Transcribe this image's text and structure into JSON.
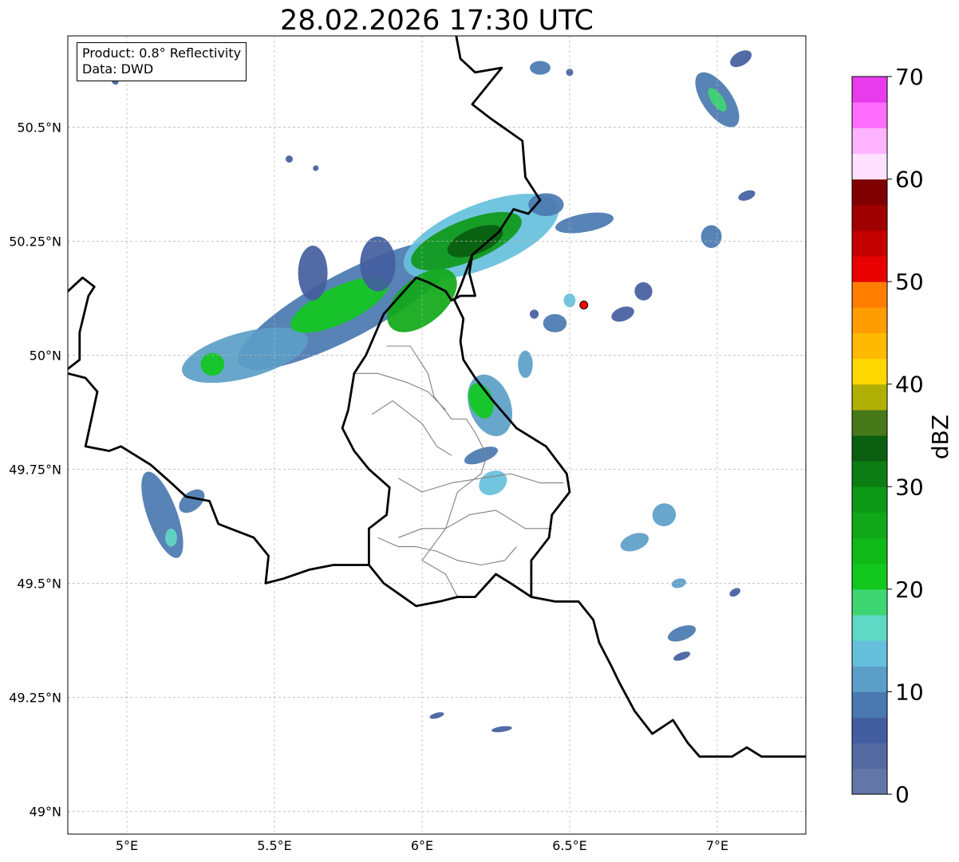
{
  "title": "28.02.2026 17:30 UTC",
  "info": {
    "product": "Product: 0.8° Reflectivity",
    "data": "Data: DWD"
  },
  "map": {
    "lon_range": [
      4.8,
      7.3
    ],
    "lat_range": [
      48.95,
      50.7
    ],
    "lon_ticks": [
      {
        "value": 5.0,
        "label": "5°E"
      },
      {
        "value": 5.5,
        "label": "5.5°E"
      },
      {
        "value": 6.0,
        "label": "6°E"
      },
      {
        "value": 6.5,
        "label": "6.5°E"
      },
      {
        "value": 7.0,
        "label": "7°E"
      }
    ],
    "lat_ticks": [
      {
        "value": 49.0,
        "label": "49°N"
      },
      {
        "value": 49.25,
        "label": "49.25°N"
      },
      {
        "value": 49.5,
        "label": "49.5°N"
      },
      {
        "value": 49.75,
        "label": "49.75°N"
      },
      {
        "value": 50.0,
        "label": "50°N"
      },
      {
        "value": 50.25,
        "label": "50.25°N"
      },
      {
        "value": 50.5,
        "label": "50.5°N"
      }
    ],
    "grid": true,
    "radar_site": {
      "lon": 6.548,
      "lat": 50.11,
      "color": "#ff0000"
    }
  },
  "colorbar": {
    "label": "dBZ",
    "min": 0,
    "max": 70,
    "tick_labels": [
      {
        "value": 0,
        "label": "0"
      },
      {
        "value": 10,
        "label": "10"
      },
      {
        "value": 20,
        "label": "20"
      },
      {
        "value": 30,
        "label": "30"
      },
      {
        "value": 40,
        "label": "40"
      },
      {
        "value": 50,
        "label": "50"
      },
      {
        "value": 60,
        "label": "60"
      },
      {
        "value": 70,
        "label": "70"
      }
    ],
    "colors": [
      "#6475a8",
      "#5469a0",
      "#435ea0",
      "#4a78b0",
      "#5b9ec8",
      "#66c0dc",
      "#5fd8c4",
      "#3ed672",
      "#12c81e",
      "#10b818",
      "#10a818",
      "#0e9818",
      "#0c7e14",
      "#0a5e10",
      "#47781a",
      "#b0b004",
      "#ffd800",
      "#ffba00",
      "#ff9c00",
      "#ff7e00",
      "#e80000",
      "#c40000",
      "#a00000",
      "#7e0000",
      "#ffe0ff",
      "#ffb4ff",
      "#ff6eff",
      "#e83cec"
    ]
  },
  "echoes": [
    {
      "lon": 5.75,
      "lat": 50.11,
      "rx": 0.42,
      "ry": 0.07,
      "rot": -28,
      "dbz": 8
    },
    {
      "lon": 5.4,
      "lat": 50.0,
      "rx": 0.22,
      "ry": 0.05,
      "rot": -15,
      "dbz": 12
    },
    {
      "lon": 5.72,
      "lat": 50.11,
      "rx": 0.18,
      "ry": 0.04,
      "rot": -25,
      "dbz": 22
    },
    {
      "lon": 6.2,
      "lat": 50.26,
      "rx": 0.28,
      "ry": 0.07,
      "rot": -22,
      "dbz": 14
    },
    {
      "lon": 6.15,
      "lat": 50.25,
      "rx": 0.2,
      "ry": 0.045,
      "rot": -22,
      "dbz": 28
    },
    {
      "lon": 6.18,
      "lat": 50.25,
      "rx": 0.1,
      "ry": 0.028,
      "rot": -22,
      "dbz": 34
    },
    {
      "lon": 6.0,
      "lat": 50.12,
      "rx": 0.14,
      "ry": 0.05,
      "rot": -40,
      "dbz": 27
    },
    {
      "lon": 6.42,
      "lat": 50.33,
      "rx": 0.06,
      "ry": 0.025,
      "rot": 0,
      "dbz": 8
    },
    {
      "lon": 6.55,
      "lat": 50.29,
      "rx": 0.1,
      "ry": 0.02,
      "rot": -10,
      "dbz": 8
    },
    {
      "lon": 5.85,
      "lat": 50.2,
      "rx": 0.06,
      "ry": 0.06,
      "rot": 0,
      "dbz": 7
    },
    {
      "lon": 5.63,
      "lat": 50.18,
      "rx": 0.05,
      "ry": 0.06,
      "rot": 0,
      "dbz": 7
    },
    {
      "lon": 5.29,
      "lat": 49.98,
      "rx": 0.04,
      "ry": 0.025,
      "rot": 0,
      "dbz": 20
    },
    {
      "lon": 6.23,
      "lat": 49.89,
      "rx": 0.07,
      "ry": 0.07,
      "rot": -20,
      "dbz": 12
    },
    {
      "lon": 6.2,
      "lat": 49.9,
      "rx": 0.04,
      "ry": 0.04,
      "rot": -20,
      "dbz": 21
    },
    {
      "lon": 6.2,
      "lat": 49.78,
      "rx": 0.06,
      "ry": 0.015,
      "rot": -20,
      "dbz": 8
    },
    {
      "lon": 6.24,
      "lat": 49.72,
      "rx": 0.05,
      "ry": 0.025,
      "rot": -30,
      "dbz": 13
    },
    {
      "lon": 6.35,
      "lat": 49.98,
      "rx": 0.025,
      "ry": 0.03,
      "rot": 0,
      "dbz": 12
    },
    {
      "lon": 5.12,
      "lat": 49.65,
      "rx": 0.05,
      "ry": 0.1,
      "rot": -20,
      "dbz": 9
    },
    {
      "lon": 5.15,
      "lat": 49.6,
      "rx": 0.02,
      "ry": 0.02,
      "rot": 0,
      "dbz": 17
    },
    {
      "lon": 5.22,
      "lat": 49.68,
      "rx": 0.05,
      "ry": 0.02,
      "rot": -40,
      "dbz": 8
    },
    {
      "lon": 6.82,
      "lat": 49.65,
      "rx": 0.04,
      "ry": 0.025,
      "rot": -25,
      "dbz": 10
    },
    {
      "lon": 6.72,
      "lat": 49.59,
      "rx": 0.05,
      "ry": 0.018,
      "rot": -20,
      "dbz": 12
    },
    {
      "lon": 7.0,
      "lat": 50.56,
      "rx": 0.05,
      "ry": 0.07,
      "rot": -35,
      "dbz": 9
    },
    {
      "lon": 7.0,
      "lat": 50.56,
      "rx": 0.02,
      "ry": 0.03,
      "rot": -35,
      "dbz": 19
    },
    {
      "lon": 7.08,
      "lat": 50.65,
      "rx": 0.04,
      "ry": 0.015,
      "rot": -30,
      "dbz": 7
    },
    {
      "lon": 6.98,
      "lat": 50.26,
      "rx": 0.035,
      "ry": 0.025,
      "rot": 0,
      "dbz": 8
    },
    {
      "lon": 7.1,
      "lat": 50.35,
      "rx": 0.03,
      "ry": 0.01,
      "rot": -20,
      "dbz": 7
    },
    {
      "lon": 6.4,
      "lat": 50.63,
      "rx": 0.035,
      "ry": 0.015,
      "rot": 0,
      "dbz": 9
    },
    {
      "lon": 6.5,
      "lat": 50.62,
      "rx": 0.012,
      "ry": 0.008,
      "rot": 0,
      "dbz": 7
    },
    {
      "lon": 6.45,
      "lat": 50.07,
      "rx": 0.04,
      "ry": 0.02,
      "rot": 0,
      "dbz": 8
    },
    {
      "lon": 6.5,
      "lat": 50.12,
      "rx": 0.02,
      "ry": 0.015,
      "rot": 0,
      "dbz": 13
    },
    {
      "lon": 6.68,
      "lat": 50.09,
      "rx": 0.04,
      "ry": 0.015,
      "rot": -20,
      "dbz": 7
    },
    {
      "lon": 6.75,
      "lat": 50.14,
      "rx": 0.03,
      "ry": 0.02,
      "rot": -20,
      "dbz": 7
    },
    {
      "lon": 6.38,
      "lat": 50.09,
      "rx": 0.015,
      "ry": 0.01,
      "rot": 0,
      "dbz": 7
    },
    {
      "lon": 6.88,
      "lat": 49.39,
      "rx": 0.05,
      "ry": 0.015,
      "rot": -20,
      "dbz": 8
    },
    {
      "lon": 6.88,
      "lat": 49.34,
      "rx": 0.03,
      "ry": 0.008,
      "rot": -20,
      "dbz": 7
    },
    {
      "lon": 6.87,
      "lat": 49.5,
      "rx": 0.025,
      "ry": 0.01,
      "rot": -15,
      "dbz": 12
    },
    {
      "lon": 7.06,
      "lat": 49.48,
      "rx": 0.02,
      "ry": 0.008,
      "rot": -30,
      "dbz": 7
    },
    {
      "lon": 5.55,
      "lat": 50.43,
      "rx": 0.012,
      "ry": 0.008,
      "rot": -50,
      "dbz": 7
    },
    {
      "lon": 5.64,
      "lat": 50.41,
      "rx": 0.01,
      "ry": 0.006,
      "rot": -40,
      "dbz": 7
    },
    {
      "lon": 4.96,
      "lat": 50.6,
      "rx": 0.01,
      "ry": 0.008,
      "rot": -50,
      "dbz": 7
    },
    {
      "lon": 6.05,
      "lat": 49.21,
      "rx": 0.025,
      "ry": 0.006,
      "rot": -15,
      "dbz": 7
    },
    {
      "lon": 6.27,
      "lat": 49.18,
      "rx": 0.035,
      "ry": 0.006,
      "rot": -8,
      "dbz": 7
    }
  ],
  "borders": {
    "national": [
      [
        [
          6.11,
          50.72
        ],
        [
          6.13,
          50.65
        ],
        [
          6.18,
          50.62
        ],
        [
          6.27,
          50.63
        ],
        [
          6.17,
          50.55
        ],
        [
          6.23,
          50.52
        ],
        [
          6.34,
          50.47
        ],
        [
          6.35,
          50.39
        ],
        [
          6.4,
          50.34
        ],
        [
          6.36,
          50.31
        ],
        [
          6.31,
          50.32
        ],
        [
          6.26,
          50.27
        ],
        [
          6.17,
          50.22
        ],
        [
          6.13,
          50.15
        ],
        [
          6.11,
          50.12
        ],
        [
          6.14,
          50.08
        ],
        [
          6.13,
          50.03
        ],
        [
          6.14,
          49.99
        ],
        [
          6.18,
          49.95
        ],
        [
          6.24,
          49.9
        ],
        [
          6.32,
          49.84
        ],
        [
          6.42,
          49.8
        ],
        [
          6.49,
          49.74
        ],
        [
          6.5,
          49.7
        ],
        [
          6.44,
          49.65
        ],
        [
          6.43,
          49.6
        ],
        [
          6.37,
          49.55
        ],
        [
          6.37,
          49.47
        ],
        [
          6.3,
          49.5
        ],
        [
          6.25,
          49.52
        ],
        [
          6.18,
          49.47
        ],
        [
          6.12,
          49.47
        ],
        [
          6.06,
          49.46
        ],
        [
          5.98,
          49.45
        ],
        [
          5.87,
          49.5
        ],
        [
          5.82,
          49.54
        ],
        [
          5.82,
          49.62
        ],
        [
          5.88,
          49.65
        ],
        [
          5.89,
          49.71
        ],
        [
          5.82,
          49.75
        ],
        [
          5.77,
          49.79
        ],
        [
          5.73,
          49.84
        ],
        [
          5.75,
          49.88
        ],
        [
          5.77,
          49.96
        ],
        [
          5.81,
          50.0
        ],
        [
          5.87,
          50.09
        ],
        [
          5.98,
          50.17
        ],
        [
          6.02,
          50.16
        ],
        [
          6.08,
          50.14
        ],
        [
          6.1,
          50.12
        ],
        [
          6.13,
          50.13
        ],
        [
          6.18,
          50.13
        ],
        [
          6.16,
          50.18
        ],
        [
          6.17,
          50.22
        ]
      ],
      [
        [
          6.37,
          49.47
        ],
        [
          6.45,
          49.46
        ],
        [
          6.53,
          49.46
        ],
        [
          6.58,
          49.42
        ],
        [
          6.6,
          49.37
        ],
        [
          6.64,
          49.32
        ],
        [
          6.67,
          49.28
        ],
        [
          6.72,
          49.22
        ],
        [
          6.78,
          49.17
        ],
        [
          6.85,
          49.2
        ],
        [
          6.9,
          49.15
        ],
        [
          6.94,
          49.12
        ],
        [
          7.05,
          49.12
        ],
        [
          7.1,
          49.14
        ],
        [
          7.15,
          49.12
        ],
        [
          7.2,
          49.12
        ],
        [
          7.25,
          49.12
        ],
        [
          7.3,
          49.12
        ]
      ],
      [
        [
          4.8,
          50.14
        ],
        [
          4.85,
          50.17
        ],
        [
          4.89,
          50.15
        ],
        [
          4.87,
          50.13
        ],
        [
          4.84,
          50.05
        ],
        [
          4.84,
          49.99
        ],
        [
          4.8,
          49.97
        ]
      ],
      [
        [
          4.8,
          49.96
        ],
        [
          4.86,
          49.95
        ],
        [
          4.9,
          49.92
        ],
        [
          4.86,
          49.8
        ],
        [
          4.94,
          49.79
        ],
        [
          4.98,
          49.8
        ],
        [
          5.08,
          49.76
        ],
        [
          5.15,
          49.72
        ],
        [
          5.2,
          49.69
        ],
        [
          5.28,
          49.68
        ],
        [
          5.31,
          49.63
        ],
        [
          5.35,
          49.62
        ],
        [
          5.43,
          49.6
        ],
        [
          5.48,
          49.56
        ],
        [
          5.47,
          49.5
        ],
        [
          5.53,
          49.51
        ],
        [
          5.62,
          49.53
        ],
        [
          5.7,
          49.54
        ],
        [
          5.82,
          49.54
        ]
      ]
    ],
    "internal": [
      [
        [
          5.88,
          50.02
        ],
        [
          5.96,
          50.02
        ],
        [
          6.02,
          49.96
        ],
        [
          6.04,
          49.91
        ],
        [
          6.1,
          49.86
        ],
        [
          6.15,
          49.86
        ],
        [
          6.18,
          49.83
        ],
        [
          6.22,
          49.78
        ],
        [
          6.2,
          49.74
        ],
        [
          6.12,
          49.7
        ],
        [
          6.08,
          49.62
        ],
        [
          6.0,
          49.55
        ],
        [
          6.08,
          49.52
        ],
        [
          6.12,
          49.47
        ]
      ],
      [
        [
          5.77,
          49.96
        ],
        [
          5.85,
          49.96
        ],
        [
          5.95,
          49.94
        ],
        [
          6.02,
          49.92
        ],
        [
          6.08,
          49.88
        ]
      ],
      [
        [
          5.83,
          49.87
        ],
        [
          5.9,
          49.9
        ],
        [
          6.0,
          49.85
        ],
        [
          6.05,
          49.8
        ],
        [
          6.1,
          49.78
        ]
      ],
      [
        [
          5.92,
          49.73
        ],
        [
          6.0,
          49.7
        ],
        [
          6.1,
          49.72
        ],
        [
          6.2,
          49.73
        ],
        [
          6.3,
          49.74
        ],
        [
          6.4,
          49.72
        ],
        [
          6.48,
          49.72
        ]
      ],
      [
        [
          5.92,
          49.6
        ],
        [
          6.0,
          49.62
        ],
        [
          6.08,
          49.62
        ],
        [
          6.16,
          49.65
        ],
        [
          6.25,
          49.66
        ],
        [
          6.35,
          49.62
        ],
        [
          6.44,
          49.62
        ]
      ],
      [
        [
          5.85,
          49.6
        ],
        [
          5.92,
          49.58
        ],
        [
          5.98,
          49.58
        ],
        [
          6.05,
          49.57
        ],
        [
          6.12,
          49.55
        ],
        [
          6.2,
          49.54
        ],
        [
          6.28,
          49.55
        ],
        [
          6.32,
          49.58
        ]
      ]
    ]
  }
}
